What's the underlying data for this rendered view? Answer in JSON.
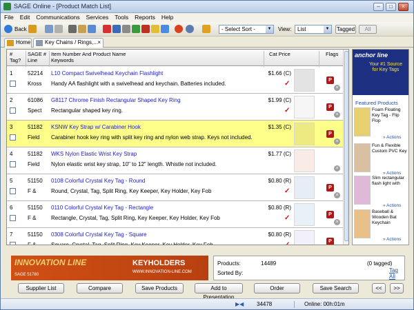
{
  "window": {
    "title": "SAGE Online - [Product Match List]"
  },
  "menu": [
    "File",
    "Edit",
    "Communications",
    "Services",
    "Tools",
    "Reports",
    "Help"
  ],
  "toolbar": {
    "back_label": "Back",
    "sort_select": "- Select Sort -",
    "view_label": "View:",
    "view_select": "List",
    "tagged_label": "Tagged",
    "all_label": "All"
  },
  "tabs": [
    {
      "label": "Home"
    },
    {
      "label": "Key Chains / Rings,..."
    }
  ],
  "grid": {
    "headers": {
      "tag": "#\nTag?",
      "line": "SAGE #\nLine",
      "item": "Item Number And Product Name\nKeywords",
      "price": "Cat Price",
      "flags": "Flags"
    },
    "rows": [
      {
        "n": "1",
        "sku": "52214",
        "vendor": "Kross",
        "name": "L10 Compact Swivelhead Keychain Flashlight",
        "desc": "Handy AA flashlight with a swivelhead and keychain. Batteries included.",
        "price": "$1.66 (C)",
        "check": true,
        "flag": true,
        "highlight": false
      },
      {
        "n": "2",
        "sku": "61086",
        "vendor": "Spect",
        "name": "G8117 Chrome Finish Rectangular Shaped Key Ring",
        "desc": "Rectangular shaped key ring.",
        "price": "$1.99 (C)",
        "check": true,
        "flag": true,
        "highlight": false
      },
      {
        "n": "3",
        "sku": "51182",
        "vendor": "Field",
        "name": "KSNW Key Strap w/ Carabiner Hook",
        "desc": "Carabiner hook key ring with split key ring and nylon web strap. Keys not included.",
        "price": "$1.35 (C)",
        "check": false,
        "flag": true,
        "highlight": true
      },
      {
        "n": "4",
        "sku": "51182",
        "vendor": "Field",
        "name": "WKS Nylon Elastic Wrist Key Strap",
        "desc": "Nylon elastic wrist key strap, 10\" to 12\" length. Whistle not included.",
        "price": "$1.77 (C)",
        "check": false,
        "flag": false,
        "highlight": false
      },
      {
        "n": "5",
        "sku": "51150",
        "vendor": "F &",
        "name": "0108 Colorful Crystal Key Tag - Round",
        "desc": "Round, Crystal, Tag, Split Ring, Key Keeper, Key Holder, Key Fob",
        "price": "$0.80 (R)",
        "check": true,
        "flag": true,
        "highlight": false
      },
      {
        "n": "6",
        "sku": "51150",
        "vendor": "F &",
        "name": "0110 Colorful Crystal Key Tag - Rectangle",
        "desc": "Rectangle, Crystal, Tag, Split Ring, Key Keeper, Key Holder, Key Fob",
        "price": "$0.80 (R)",
        "check": true,
        "flag": true,
        "highlight": false
      },
      {
        "n": "7",
        "sku": "51150",
        "vendor": "F &",
        "name": "0308 Colorful Crystal Key Tag - Square",
        "desc": "Square, Crystal, Tag, Split Ring, Key Keeper, Key Holder, Key Fob",
        "price": "$0.80 (R)",
        "check": true,
        "flag": true,
        "highlight": false
      }
    ]
  },
  "side": {
    "ad_brand": "anchor line",
    "ad_tagline": "Your #1 Source for Key Tags",
    "featured_title": "Featured Products",
    "featured": [
      {
        "text": "Foam Floating Key Tag - Flip Flop",
        "action": "» Actions"
      },
      {
        "text": "Fun & Flexible Custom PVC Key",
        "action": "» Actions"
      },
      {
        "text": "Slim rectangular flash light with",
        "action": "» Actions"
      },
      {
        "text": "Baseball & Wooden Bat Keychain",
        "action": "» Actions"
      }
    ]
  },
  "banner": {
    "brand": "INNOVATION LINE",
    "headline": "KEYHOLDERS",
    "url": "WWW.INNOVATION-LINE.COM",
    "sage": "SAGE 51780"
  },
  "info": {
    "products_label": "Products:",
    "products_value": "14489",
    "sorted_label": "Sorted By:",
    "tagged_count": "(0 tagged)",
    "tag_all": "Tag All"
  },
  "buttons": {
    "supplier_list": "Supplier List",
    "compare": "Compare",
    "save_products": "Save Products",
    "add_presentation": "Add to Presentation",
    "order": "Order",
    "save_search": "Save Search",
    "prev": "<<",
    "next": ">>"
  },
  "status": {
    "code": "34478",
    "online": "Online: 00h:01m"
  }
}
